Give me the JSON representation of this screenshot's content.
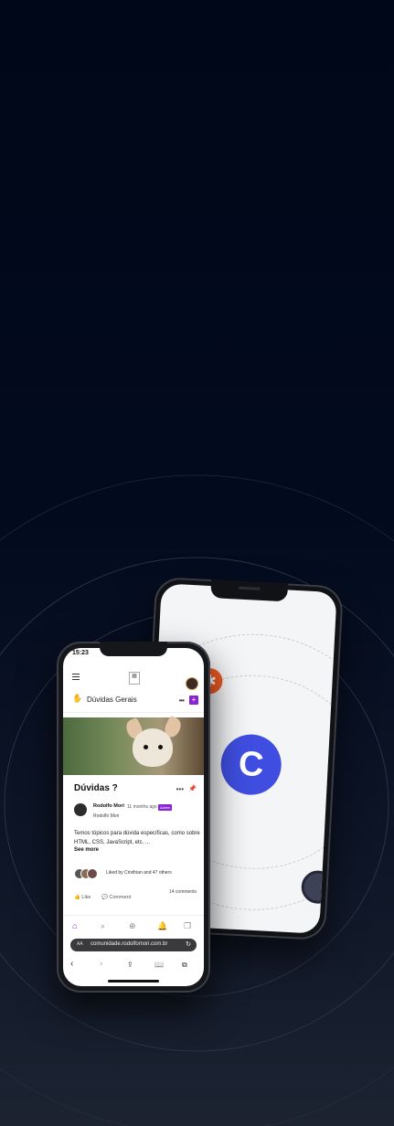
{
  "status_bar": {
    "time": "15:23"
  },
  "group": {
    "icon": "hand-wave-icon",
    "title": "Dúvidas Gerais"
  },
  "post": {
    "title": "Dúvidas ?",
    "author": "Rodolfo Mori",
    "time": "11 months ago",
    "badge": "Admin",
    "author_sub": "Rodolfo Mori",
    "body": "Temos tópicos para dúvida específicas, como sobre HTML, CSS, JavaScript, etc. ...",
    "see_more": "See more",
    "liked_by": "Liked by Cristhian and 47 others",
    "comments": "14 comments",
    "like_label": "Like",
    "comment_label": "Comment"
  },
  "browser": {
    "aa": "AA",
    "url": "comunidade.rodolfomori.com.br"
  },
  "back_phone": {
    "logo_letter": "C"
  },
  "colors": {
    "accent": "#8a22d8",
    "orange": "#f15a24",
    "logo_blue": "#3f4ee0",
    "cyan": "#44e0ee"
  }
}
